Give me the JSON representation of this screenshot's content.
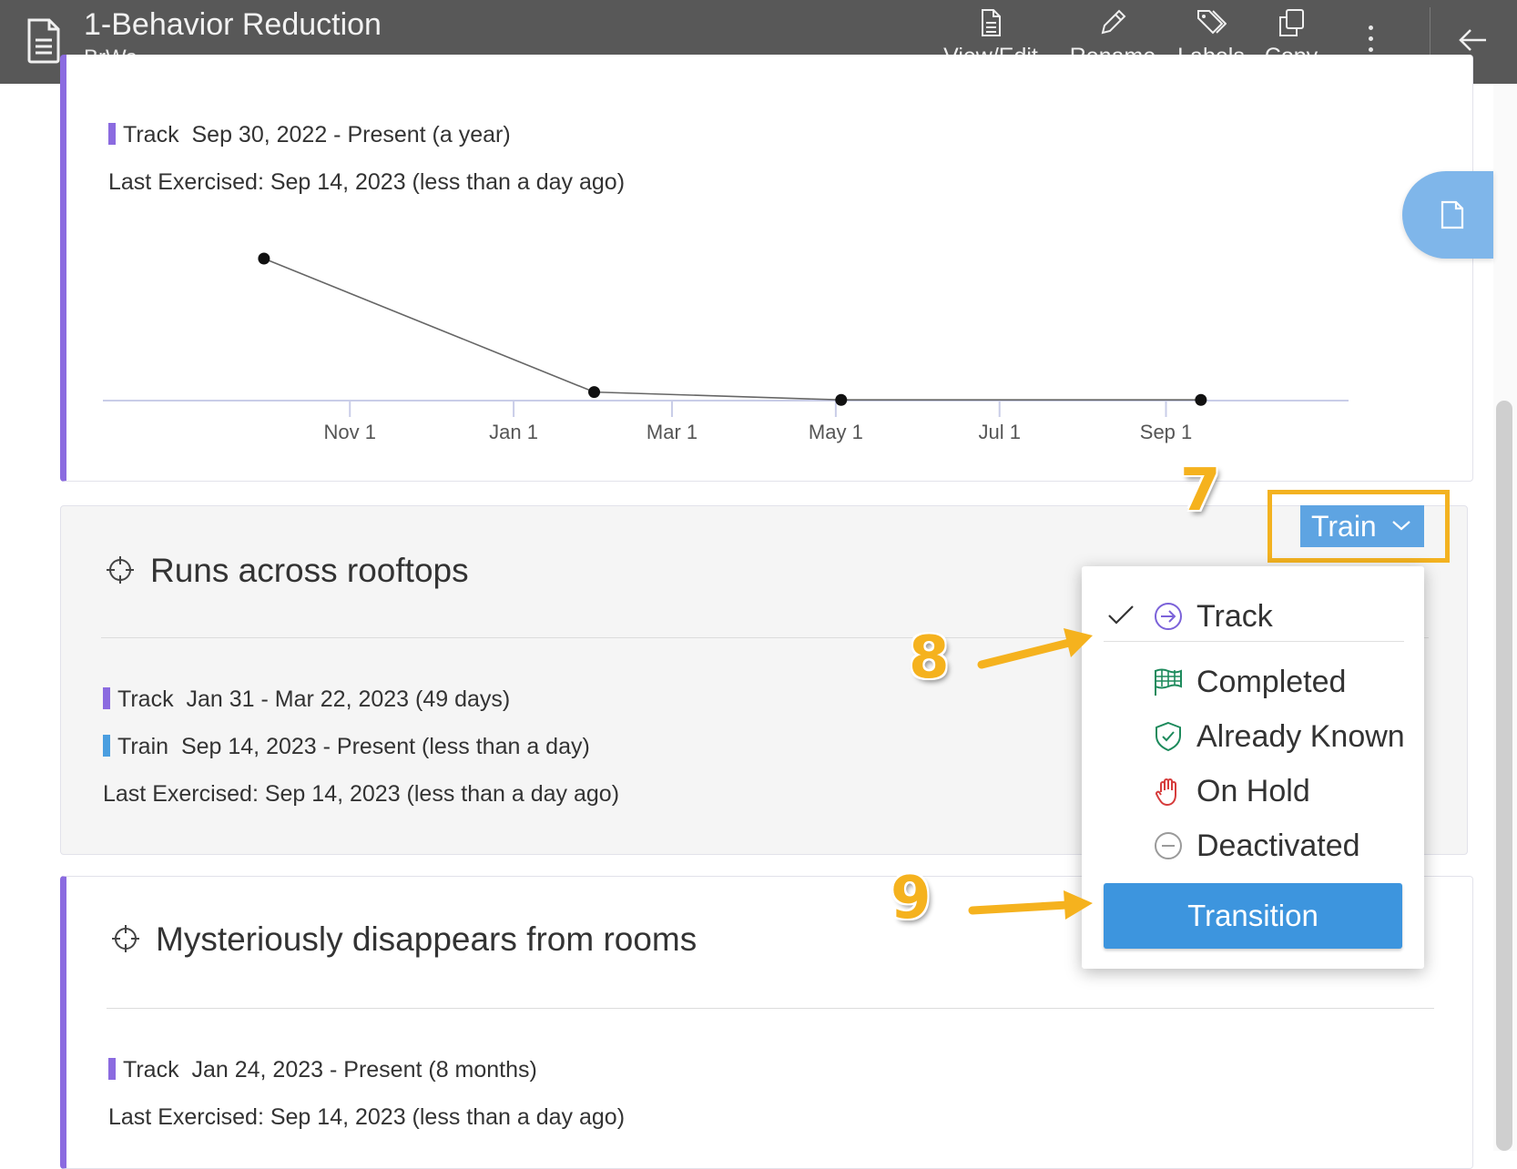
{
  "header": {
    "title": "1-Behavior Reduction",
    "subtitle": "BrWa",
    "tools": [
      {
        "label": "View/Edit",
        "icon": "document-icon"
      },
      {
        "label": "Rename",
        "icon": "pencil-icon"
      },
      {
        "label": "Labels",
        "icon": "tags-icon"
      },
      {
        "label": "Copy",
        "icon": "copy-icon"
      }
    ],
    "more_icon": "more-vertical-icon",
    "back_icon": "arrow-left-icon"
  },
  "colors": {
    "track": "#8b6be0",
    "train": "#4a9ee0",
    "highlight": "#f3b220",
    "transition_button": "#3d95de"
  },
  "card1": {
    "track_label": "Track",
    "track_range": "Sep 30, 2022 - Present (a year)",
    "last_exercised": "Last Exercised: Sep 14, 2023 (less than a day ago)"
  },
  "chart_data": {
    "type": "line",
    "x_ticks": [
      "Nov 1",
      "Jan 1",
      "Mar 1",
      "May 1",
      "Jul 1",
      "Sep 1"
    ],
    "series": [
      {
        "points": [
          {
            "x": "2022-09-30",
            "y": 1
          },
          {
            "x": "2023-01-31",
            "y": 0.06
          },
          {
            "x": "2023-05-03",
            "y": 0.005
          },
          {
            "x": "2023-09-14",
            "y": 0.005
          }
        ]
      }
    ],
    "ylim": [
      0,
      1.1
    ],
    "grid": false
  },
  "card2": {
    "title": "Runs across rooftops",
    "track_label": "Track",
    "track_range": "Jan 31 - Mar 22, 2023 (49 days)",
    "train_label": "Train",
    "train_range": "Sep 14, 2023 - Present (less than a day)",
    "last_exercised": "Last Exercised: Sep 14, 2023 (less than a day ago)",
    "phase_button": "Train"
  },
  "dropdown": {
    "items": [
      {
        "label": "Track",
        "icon": "arrow-circle-icon",
        "selected": true
      },
      {
        "label": "Completed",
        "icon": "flag-icon",
        "selected": false
      },
      {
        "label": "Already Known",
        "icon": "shield-check-icon",
        "selected": false
      },
      {
        "label": "On Hold",
        "icon": "hand-icon",
        "selected": false
      },
      {
        "label": "Deactivated",
        "icon": "minus-circle-icon",
        "selected": false
      }
    ],
    "transition_label": "Transition"
  },
  "card3": {
    "title": "Mysteriously disappears from rooms",
    "track_label": "Track",
    "track_range": "Jan 24, 2023 - Present (8 months)",
    "last_exercised": "Last Exercised: Sep 14, 2023 (less than a day ago)"
  },
  "annotations": {
    "step7": "7",
    "step8": "8",
    "step9": "9"
  }
}
